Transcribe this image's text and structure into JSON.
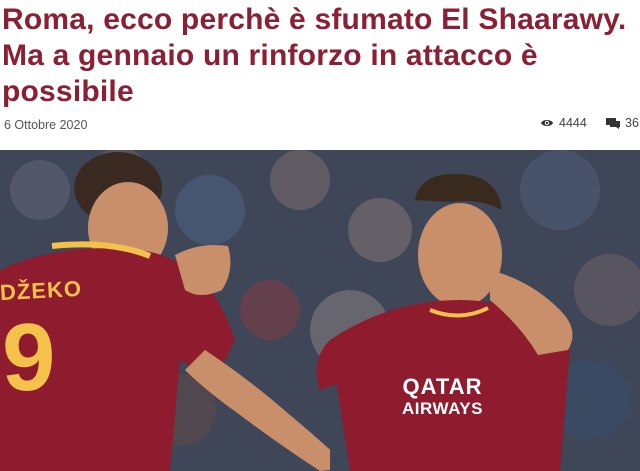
{
  "article": {
    "title": "Roma, ecco perchè è sfumato El Shaarawy. Ma a gennaio un rinforzo in attacco è possibile",
    "date": "6 Ottobre 2020",
    "views": "4444",
    "comments": "36"
  },
  "icons": {
    "views": "eye-icon",
    "comments": "comment-icon"
  },
  "photo": {
    "shirt_name": "DŽEKO",
    "shirt_number": "9",
    "sponsor_line1": "QATAR",
    "sponsor_line2": "AIRWAYS"
  },
  "colors": {
    "headline": "#8b1f33",
    "kit_red": "#8e1b2e",
    "kit_gold": "#f4c24a"
  }
}
